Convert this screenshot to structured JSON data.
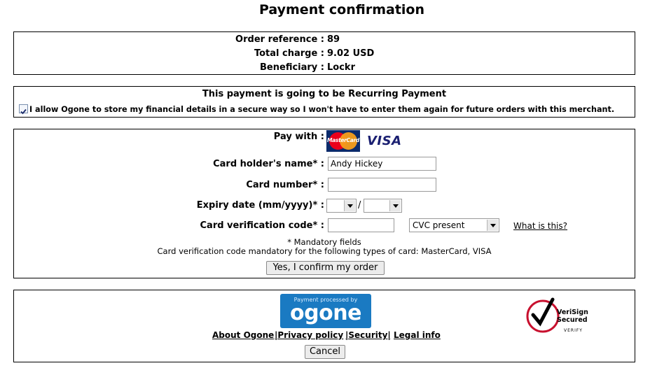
{
  "page": {
    "title": "Payment confirmation"
  },
  "order": {
    "reference_label": "Order reference :",
    "reference_value": "89",
    "total_label": "Total charge :",
    "total_value": "9.02 USD",
    "beneficiary_label": "Beneficiary :",
    "beneficiary_value": "Lockr"
  },
  "recurring": {
    "heading": "This payment is going to be Recurring Payment",
    "consent_checked": true,
    "consent_text": "I allow Ogone to store my financial details in a secure way so I won't have to enter them again for future orders with this merchant."
  },
  "form": {
    "pay_with_label": "Pay with :",
    "card_brands": [
      "MasterCard",
      "VISA"
    ],
    "holder_label": "Card holder's name* :",
    "holder_value": "Andy Hickey",
    "number_label": "Card number* :",
    "number_value": "",
    "expiry_label": "Expiry date (mm/yyyy)* :",
    "expiry_separator": "/",
    "expiry_month": "",
    "expiry_year": "",
    "cvc_label": "Card verification code* :",
    "cvc_value": "",
    "cvc_presence": "CVC present",
    "cvc_help_link": "What is this?",
    "mandatory_note": "* Mandatory fields",
    "cvc_note": "Card verification code mandatory for the following types of card: MasterCard, VISA",
    "confirm_button": "Yes, I confirm my order"
  },
  "footer": {
    "ogone_small": "Payment processed by",
    "ogone_logo": "ogone",
    "verisign_line1": "VeriSign",
    "verisign_line2": "Secured",
    "verisign_verify": "VERIFY",
    "links": [
      "About Ogone",
      "|Privacy policy",
      "|Security|",
      "Legal info"
    ],
    "cancel_button": "Cancel"
  },
  "colors": {
    "ogone_blue": "#1a7ac2",
    "verisign_red": "#c8102e"
  }
}
